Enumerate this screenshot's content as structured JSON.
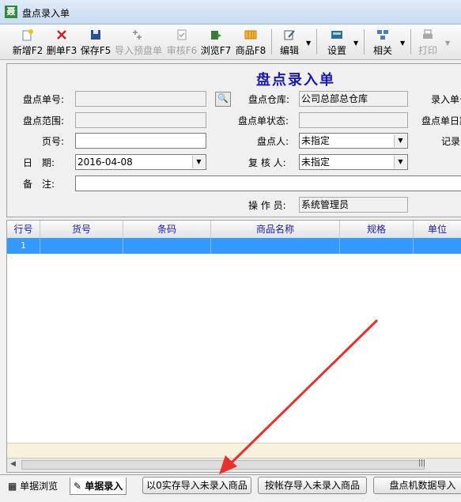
{
  "window": {
    "title": "盘点录入单",
    "icon": "app-icon",
    "icon_text": "聂"
  },
  "toolbar": {
    "buttons": [
      {
        "label": "新增F2",
        "icon": "new-doc-icon",
        "enabled": true
      },
      {
        "label": "删单F3",
        "icon": "delete-x-icon",
        "enabled": true
      },
      {
        "label": "保存F5",
        "icon": "save-disk-icon",
        "enabled": true
      },
      {
        "label": "导入预盘单",
        "icon": "import-icon",
        "enabled": false
      },
      {
        "label": "审核F6",
        "icon": "audit-icon",
        "enabled": false
      },
      {
        "label": "浏览F7",
        "icon": "browse-icon",
        "enabled": true
      },
      {
        "label": "商品F8",
        "icon": "goods-icon",
        "enabled": true
      },
      {
        "label": "编辑",
        "icon": "edit-icon",
        "enabled": true
      },
      {
        "label": "设置",
        "icon": "settings-icon",
        "enabled": true
      },
      {
        "label": "相关",
        "icon": "related-icon",
        "enabled": true
      },
      {
        "label": "打印",
        "icon": "print-icon",
        "enabled": false
      }
    ]
  },
  "form": {
    "heading": "盘点录入单",
    "labels": {
      "order_no": "盘点单号:",
      "warehouse": "盘点仓库:",
      "entry_no": "录入单号",
      "range": "盘点范围:",
      "status": "盘点单状态:",
      "order_date": "盘点单日期",
      "page_no": "页号:",
      "counter": "盘点人:",
      "recorder": "记录",
      "date": "日　期:",
      "checker": "复 核 人:",
      "remark": "备　注:",
      "operator": "操 作 员:"
    },
    "values": {
      "warehouse": "公司总部总仓库",
      "date": "2016-04-08",
      "counter": "未指定",
      "checker": "未指定",
      "operator": "系统管理员"
    }
  },
  "grid": {
    "columns": [
      "行号",
      "货号",
      "条码",
      "商品名称",
      "规格",
      "单位"
    ],
    "rows": [
      {
        "row_no": "1"
      }
    ]
  },
  "bottom": {
    "tabs": [
      "单据浏览",
      "单据录入"
    ],
    "active_tab": "单据录入",
    "buttons": [
      "以0实存导入未录入商品",
      "按帐存导入未录入商品",
      "盘点机数据导入"
    ]
  },
  "annotation": {
    "color": "#e8312a"
  }
}
